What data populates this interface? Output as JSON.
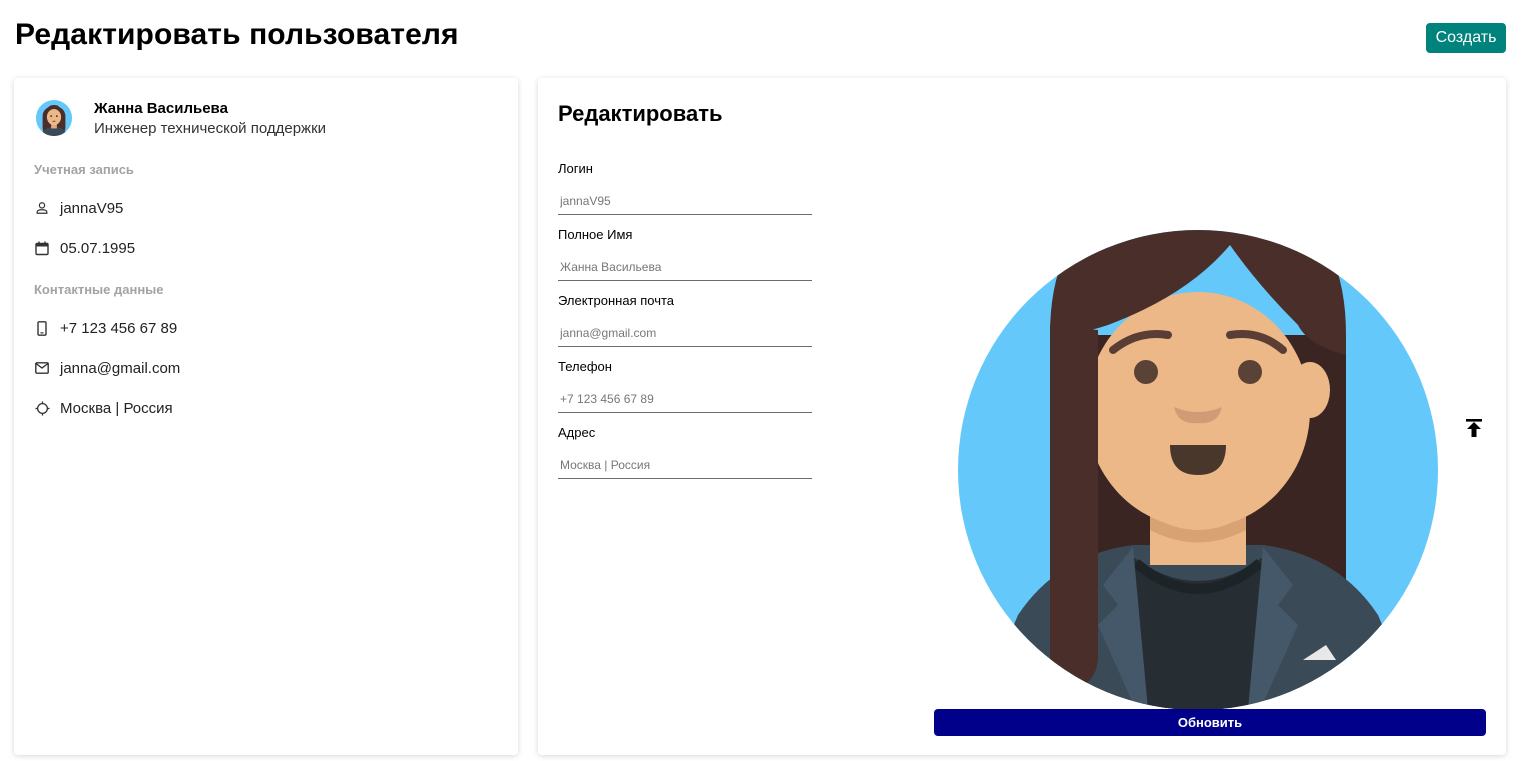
{
  "header": {
    "title": "Редактировать пользователя",
    "create_label": "Создать"
  },
  "profile": {
    "name": "Жанна Васильева",
    "role": "Инженер технической поддержки",
    "account_section": "Учетная запись",
    "login": "jannaV95",
    "birthdate": "05.07.1995",
    "contacts_section": "Контактные данные",
    "phone": "+7 123 456 67 89",
    "email": "janna@gmail.com",
    "address": "Москва | Россия"
  },
  "form": {
    "title": "Редактировать",
    "fields": [
      {
        "label": "Логин",
        "placeholder": "jannaV95"
      },
      {
        "label": "Полное Имя",
        "placeholder": "Жанна Васильева"
      },
      {
        "label": "Электронная почта",
        "placeholder": "janna@gmail.com"
      },
      {
        "label": "Телефон",
        "placeholder": "+7 123 456 67 89"
      },
      {
        "label": "Адрес",
        "placeholder": "Москва | Россия"
      }
    ],
    "update_label": "Обновить"
  },
  "icons": {
    "user": "person-icon",
    "calendar": "calendar-icon",
    "phone": "phone-icon",
    "email": "mail-icon",
    "location": "location-icon",
    "upload": "upload-icon"
  },
  "colors": {
    "create_button": "#00827d",
    "update_button": "#00008b",
    "avatar_background": "#64c8fb"
  }
}
